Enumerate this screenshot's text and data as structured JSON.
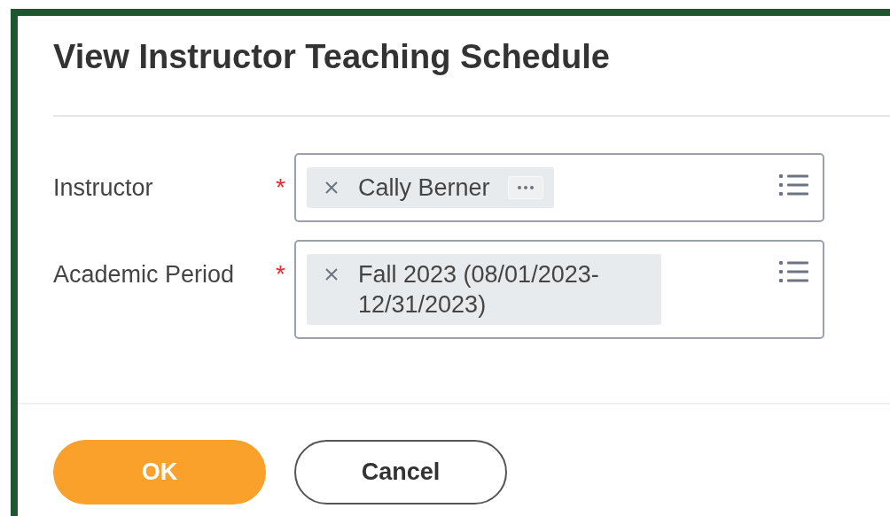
{
  "title": "View Instructor Teaching Schedule",
  "fields": [
    {
      "label": "Instructor",
      "required_mark": "*",
      "value": "Cally Berner",
      "related_actions": true
    },
    {
      "label": "Academic Period",
      "required_mark": "*",
      "value": "Fall 2023 (08/01/2023-12/31/2023)",
      "related_actions": false
    }
  ],
  "buttons": [
    {
      "label": "OK",
      "kind": "primary"
    },
    {
      "label": "Cancel",
      "kind": "secondary"
    }
  ]
}
